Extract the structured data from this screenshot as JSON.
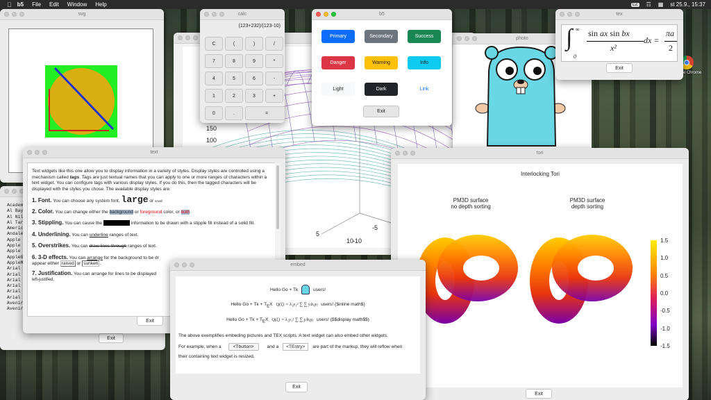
{
  "menubar": {
    "app": "b5",
    "items": [
      "File",
      "Edit",
      "Window",
      "Help"
    ],
    "input_badge": "CZ",
    "datetime": "st 25.9., 15:37"
  },
  "desktop": {
    "chrome_label": "Google Chrome"
  },
  "svg_window": {
    "title": "svg"
  },
  "fonts_window": {
    "items": [
      "Academ",
      "Al Bay",
      "Al Nil",
      "Al Tar",
      "Americ",
      "Andale",
      "Apple",
      "Apple",
      "Apple",
      "AppleG",
      "AppleM",
      "Arial",
      "Arial",
      "Arial",
      "Arial",
      "Arial",
      "Arial",
      "Avenir",
      "Avenir"
    ],
    "exit_label": "Exit"
  },
  "plot3d_window": {
    "y_ticks": [
      "150",
      "100"
    ],
    "x_ticks": [
      "5",
      "10",
      "-5",
      "-10"
    ],
    "exit_label": "Exit"
  },
  "calc_window": {
    "title": "calc",
    "display": "(123+232)/(123-10)",
    "keys": [
      [
        "C",
        "(",
        ")",
        "/"
      ],
      [
        "7",
        "8",
        "9",
        "*"
      ],
      [
        "4",
        "5",
        "6",
        "-"
      ],
      [
        "1",
        "2",
        "3",
        "+"
      ],
      [
        "0",
        ".",
        "="
      ]
    ]
  },
  "b5_window": {
    "title": "b5",
    "buttons": [
      {
        "label": "Primary",
        "bg": "#0d6efd",
        "fg": "#ffffff"
      },
      {
        "label": "Secondary",
        "bg": "#6c757d",
        "fg": "#ffffff"
      },
      {
        "label": "Success",
        "bg": "#198754",
        "fg": "#ffffff"
      },
      {
        "label": "Danger",
        "bg": "#dc3545",
        "fg": "#ffffff"
      },
      {
        "label": "Warning",
        "bg": "#ffc107",
        "fg": "#222222"
      },
      {
        "label": "Info",
        "bg": "#0dcaf0",
        "fg": "#222222"
      },
      {
        "label": "Light",
        "bg": "#f8f9fa",
        "fg": "#222222"
      },
      {
        "label": "Dark",
        "bg": "#212529",
        "fg": "#ffffff"
      },
      {
        "label": "Link",
        "bg": "#ffffff",
        "fg": "#0d6efd"
      }
    ],
    "exit_label": "Exit"
  },
  "photo_window": {
    "title": "photo"
  },
  "tex_window": {
    "title": "tex",
    "exit_label": "Exit"
  },
  "text_window": {
    "title": "text",
    "intro_1": "Text widgets like this one allow you to display information in a variety of styles. Display styles are controlled using a mechanism called ",
    "intro_tags": "tags",
    "intro_2": ". Tags are just textual names that you can apply to one or more ranges of characters within a text widget. You can configure tags with various display styles. If you do this, then the tagged characters will be displayed with the styles you chose. The available display styles are:",
    "font_h": "1. Font.",
    "font_t": " You can choose any system font, ",
    "font_large": "large",
    "font_or": " or ",
    "font_small": "small",
    "color_h": "2. Color.",
    "color_t1": " You can change either the ",
    "color_bg": "background",
    "color_or": " or ",
    "color_fg": "foreground",
    "color_t2": " color, or ",
    "color_both": "both",
    "stip_h": "3. Stippling.",
    "stip_t1": " You can cause the ",
    "stip_t2": " information to be drawn with a stipple fill instead of a solid fill.",
    "und_h": "4. Underlining.",
    "und_t1": " You can ",
    "und_u": "underline",
    "und_t2": " ranges of text.",
    "ovr_h": "5. Overstrikes.",
    "ovr_t1": " You can ",
    "ovr_s": "draw lines through",
    "ovr_t2": " ranges of text.",
    "d3_h": "6. 3-D effects.",
    "d3_t1": " You can ",
    "d3_arr": "arrange",
    "d3_t2": " for the background to be dr",
    "d3_t3": "appear either ",
    "d3_raised": "raised",
    "d3_or": " or ",
    "d3_sunken": "sunken",
    "just_h": "7. Justification.",
    "just_t": " You can arrange for lines to be displayed",
    "just_cut": "left-justified,",
    "exit_label": "Exit"
  },
  "tori_window": {
    "title": "tori",
    "plot_title": "Interlocking Tori",
    "left_label_1": "PM3D surface",
    "left_label_2": "no depth sorting",
    "right_label_1": "PM3D surface",
    "right_label_2": "depth sorting",
    "colorbar_ticks": [
      "1.5",
      "1.0",
      "0.5",
      "0.0",
      "-0.5",
      "-1.0",
      "-1.5"
    ],
    "exit_label": "Exit"
  },
  "embed_window": {
    "title": "embed",
    "line1": "Hello Go + Tk",
    "line1_end": "users!",
    "line2_pre": "Hello Go + Tk + T",
    "line2_tex": "E",
    "line2_x": "X",
    "line2_formula": "Q(ξ) = λ₁y₁² ∑ ∑ yᵢbᵢⱼyⱼ",
    "line2_end": "users! ($inline math$)",
    "line3_pre": "Hello Go + Tk + T",
    "line3_tex": "E",
    "line3_x": "X",
    "line3_formula": "Q(ξ) = λ₁y₁² ∑ ∑ yᵢbᵢⱼyⱼ",
    "line3_end": "users! ($$display math$$)",
    "para1": "The above exemplifies embeding pictures and TEX scripts. A text widget can also embed other widgets.",
    "para2_a": "For example, when a",
    "btn1": "<Tbutton>",
    "para2_b": "and a",
    "btn2": "<TEntry>",
    "para2_c": "are part of the markup, they will reflow when",
    "para3": "their containing text widget is resized.",
    "exit_label": "Exit"
  }
}
